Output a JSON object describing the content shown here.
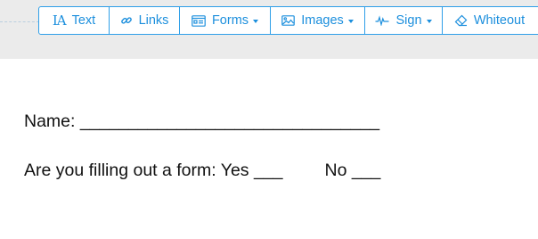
{
  "toolbar": {
    "items": [
      {
        "label": "Text",
        "icon": "text-cursor-icon",
        "dropdown": false
      },
      {
        "label": "Links",
        "icon": "link-icon",
        "dropdown": false
      },
      {
        "label": "Forms",
        "icon": "form-icon",
        "dropdown": true
      },
      {
        "label": "Images",
        "icon": "image-icon",
        "dropdown": true
      },
      {
        "label": "Sign",
        "icon": "signature-icon",
        "dropdown": true
      },
      {
        "label": "Whiteout",
        "icon": "eraser-icon",
        "dropdown": false
      }
    ],
    "accent_color": "#1c8fdd"
  },
  "document": {
    "name_line": "Name: _______________________________",
    "question_line": "Are you filling out a form: Yes ___",
    "no_option": "No ___"
  }
}
